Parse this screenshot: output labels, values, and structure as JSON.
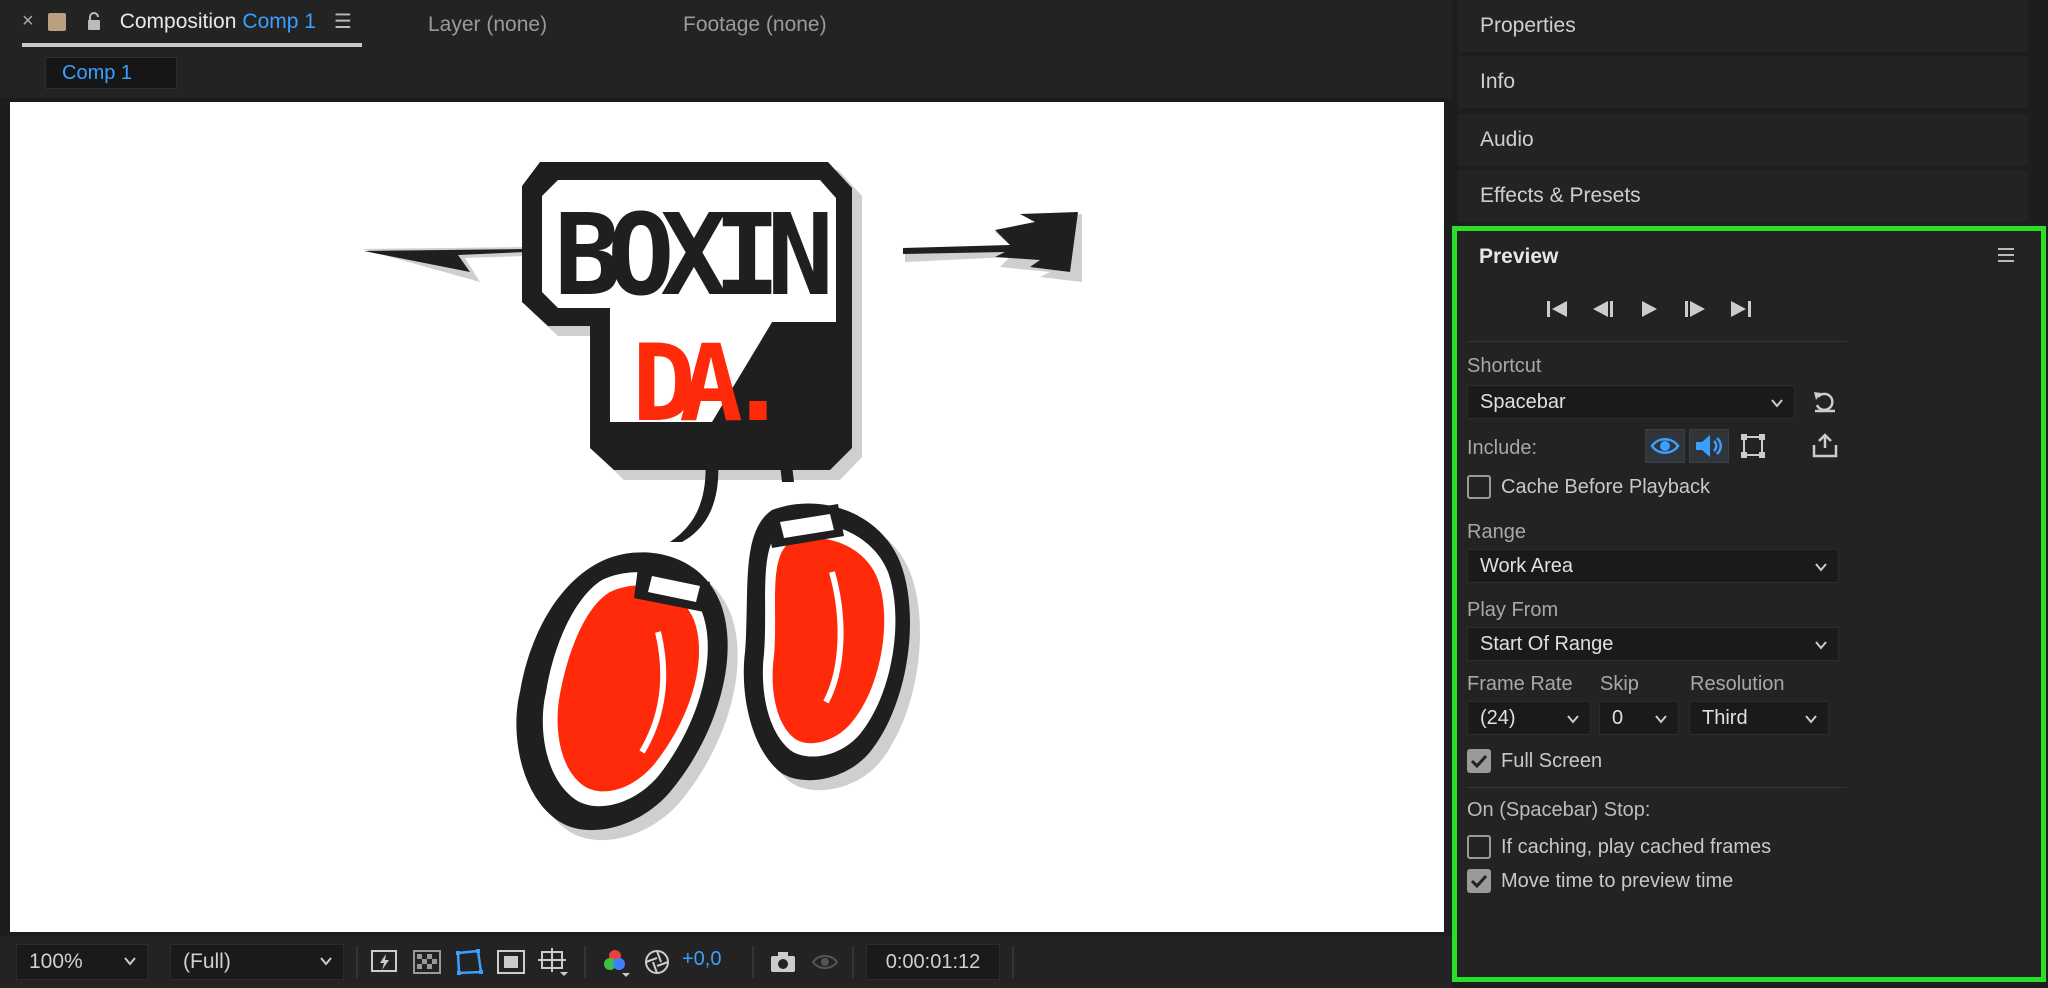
{
  "composition_tabs": {
    "composition_label": "Composition",
    "comp_name": "Comp 1",
    "layer_tab": "Layer (none)",
    "footage_tab": "Footage (none)"
  },
  "comp_chip": "Comp 1",
  "viewer": {
    "logo_line1": "BOXIN",
    "logo_line2": "DA."
  },
  "view_toolbar": {
    "zoom": "100%",
    "resolution": "(Full)",
    "exposure": "+0,0",
    "timecode": "0:00:01:12"
  },
  "panels": {
    "properties": "Properties",
    "info": "Info",
    "audio": "Audio",
    "effects_presets": "Effects & Presets"
  },
  "preview": {
    "title": "Preview",
    "shortcut_label": "Shortcut",
    "shortcut_value": "Spacebar",
    "include_label": "Include:",
    "cache_before_playback": "Cache Before Playback",
    "range_label": "Range",
    "range_value": "Work Area",
    "play_from_label": "Play From",
    "play_from_value": "Start Of Range",
    "frame_rate_label": "Frame Rate",
    "frame_rate_value": "(24)",
    "skip_label": "Skip",
    "skip_value": "0",
    "resolution_label": "Resolution",
    "resolution_value": "Third",
    "full_screen": "Full Screen",
    "stop_label": "On (Spacebar) Stop:",
    "if_caching": "If caching, play cached frames",
    "move_time": "Move time to preview time"
  },
  "checkbox_states": {
    "cache_before_playback": false,
    "full_screen": true,
    "if_caching": false,
    "move_time": true
  },
  "colors": {
    "accent_blue": "#3aa0ff",
    "highlight_green": "#2adf2a",
    "logo_red": "#ff2a0a",
    "logo_dark": "#1f1f1f"
  }
}
